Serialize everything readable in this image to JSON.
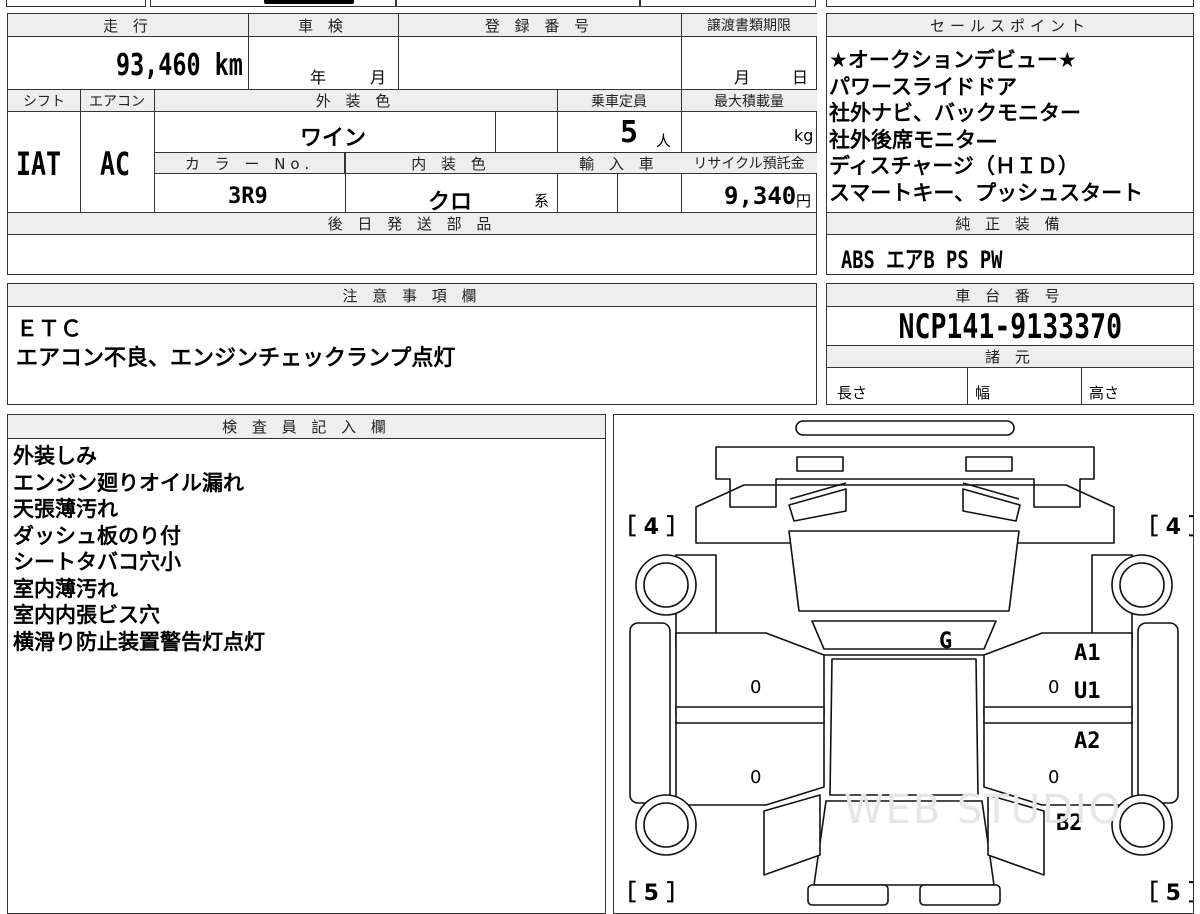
{
  "vehicle": {
    "mileage_label": "走 行",
    "mileage": "93,460 km",
    "inspection_label": "車 検",
    "inspection_year_unit": "年",
    "inspection_month_unit": "月",
    "registration_label": "登 録 番 号",
    "transfer_label": "譲渡書類期限",
    "transfer_month_unit": "月",
    "transfer_day_unit": "日",
    "shift_label": "シフト",
    "shift": "IAT",
    "ac_label": "エアコン",
    "ac": "AC",
    "exterior_color_label": "外 装 色",
    "exterior_color": "ワイン",
    "capacity_label": "乗車定員",
    "capacity": "5",
    "capacity_unit": "人",
    "max_load_label": "最大積載量",
    "max_load_unit": "kg",
    "color_no_label": "カ ラ ー No.",
    "color_no": "3R9",
    "interior_color_label": "内 装 色",
    "interior_color": "クロ",
    "interior_color_suffix": "系",
    "import_label": "輸 入 車",
    "recycle_label": "リサイクル預託金",
    "recycle_fee": "9,340",
    "recycle_unit": "円",
    "later_parts_label": "後 日 発 送 部 品"
  },
  "sales_points": {
    "label": "セールスポイント",
    "items": [
      "★オークションデビュー★",
      "パワースライドドア",
      "社外ナビ、バックモニター",
      "社外後席モニタ—",
      "ディスチャージ（ＨＩＤ）",
      "スマートキー、プッシュスタート"
    ]
  },
  "genuine_equipment": {
    "label": "純 正 装 備",
    "value": "ABS エアB PS PW"
  },
  "notes": {
    "label": "注 意 事 項 欄",
    "lines": [
      "ＥＴＣ",
      "エアコン不良、エンジンチェックランプ点灯"
    ]
  },
  "chassis": {
    "label": "車 台 番 号",
    "number": "NCP141-9133370",
    "specs_label": "諸 元",
    "length_label": "長さ",
    "width_label": "幅",
    "height_label": "高さ"
  },
  "inspector": {
    "label": "検 査 員 記 入 欄",
    "lines": [
      "外装しみ",
      "エンジン廻りオイル漏れ",
      "天張薄汚れ",
      "ダッシュ板のり付",
      "シートタバコ穴小",
      "室内薄汚れ",
      "室内内張ビス穴",
      "横滑り防止装置警告灯点灯"
    ]
  },
  "diagram": {
    "tire_front_left": "［ 4 ］",
    "tire_front_right": "［ 4 ］",
    "tire_rear_left": "［ 5 ］",
    "tire_rear_right": "［ 5 ］",
    "mark_g": "G",
    "mark_a1": "A1",
    "mark_u1": "U1",
    "mark_a2": "A2",
    "mark_b2": "B2",
    "zero": "0",
    "watermark": "WEB STUDIO"
  }
}
